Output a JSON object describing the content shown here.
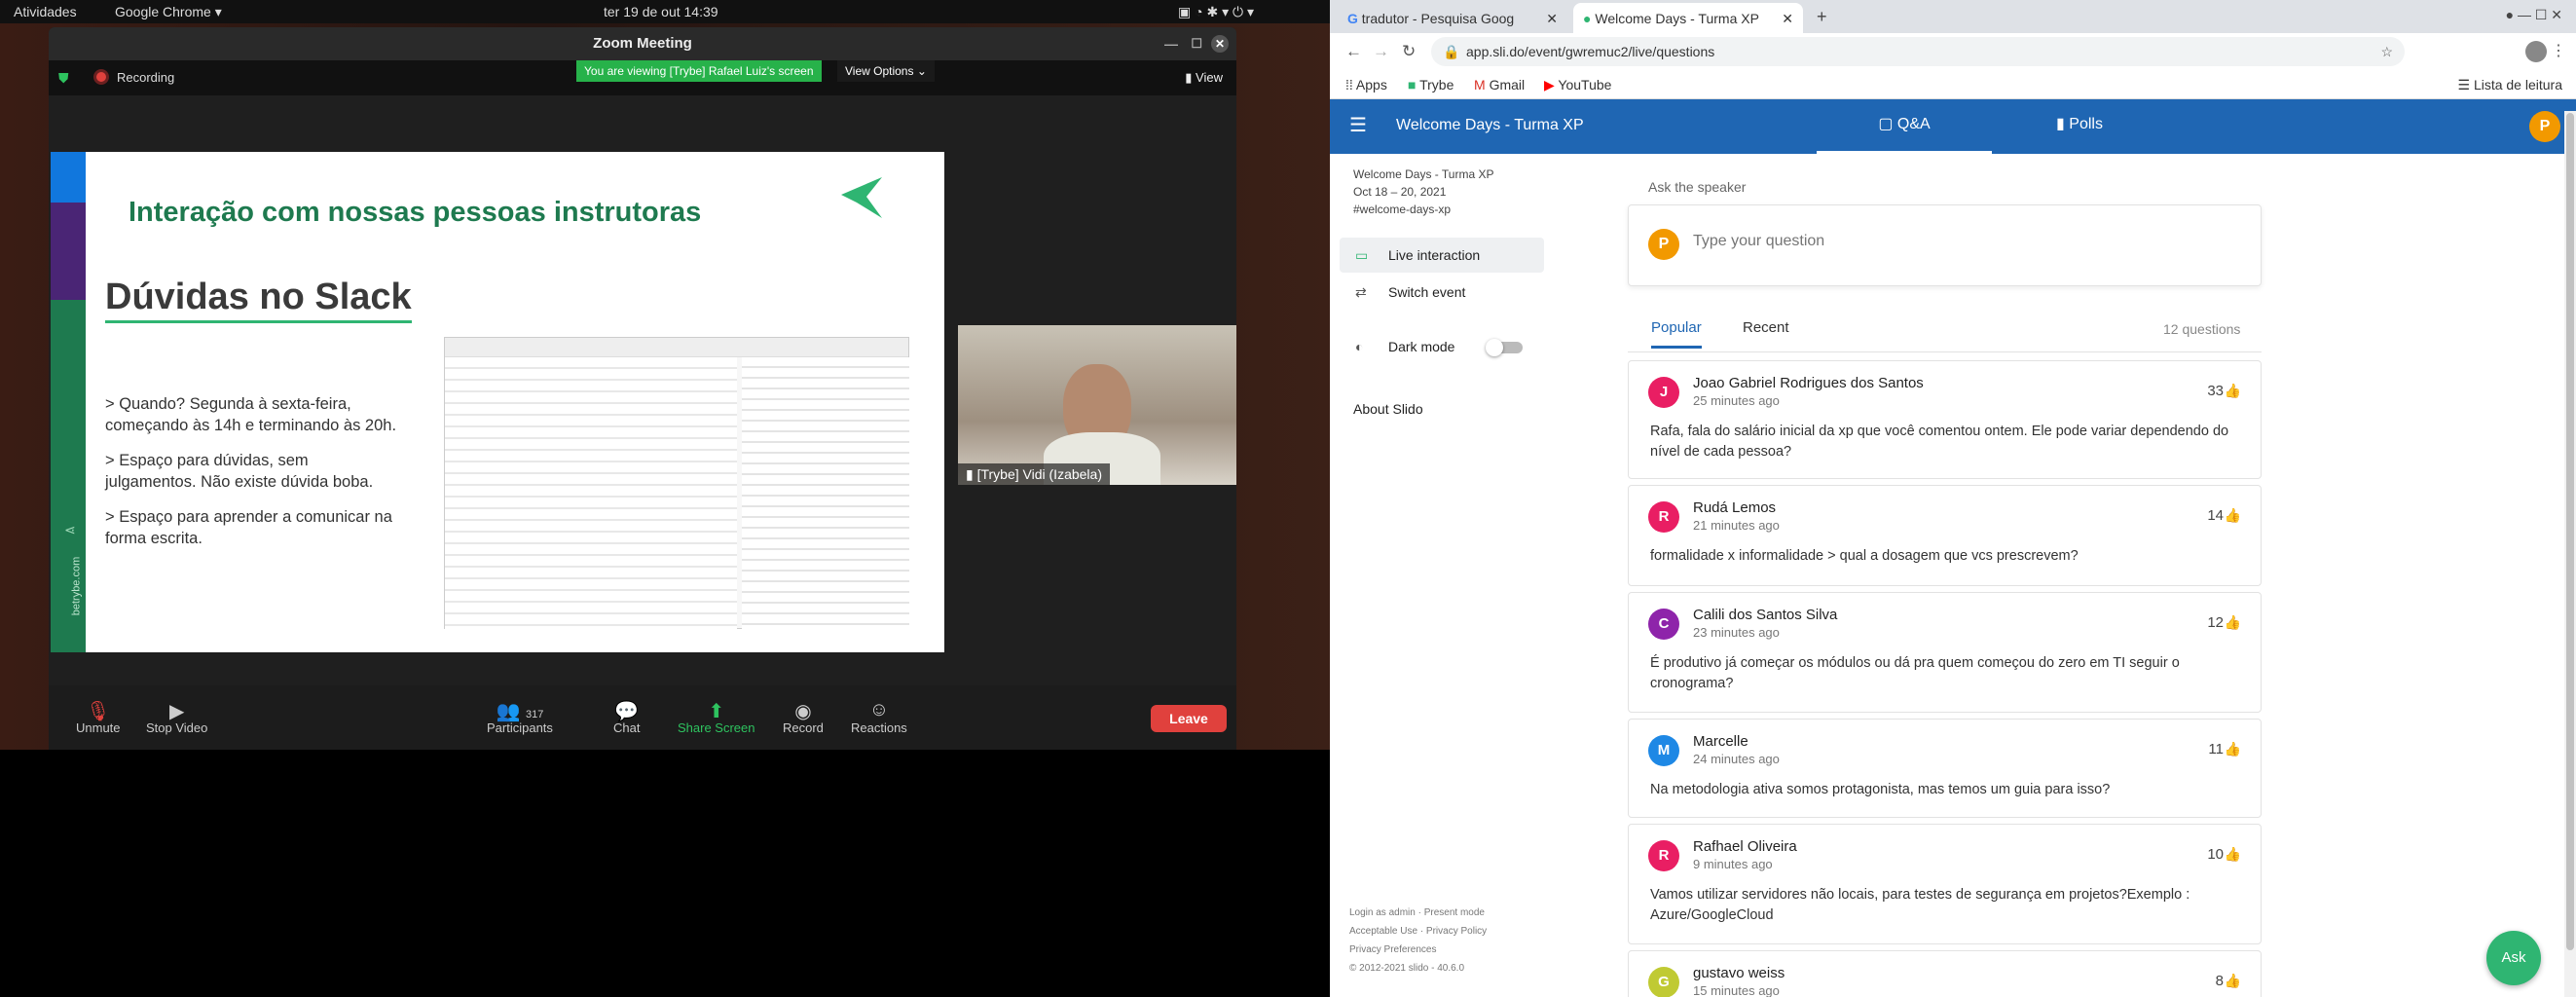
{
  "os_bar": {
    "activities": "Atividades",
    "app": "Google Chrome ▾",
    "clock": "ter 19 de out 14:39"
  },
  "zoom": {
    "title": "Zoom Meeting",
    "recording": "Recording",
    "viewing_banner": "You are viewing [Trybe] Rafael Luiz's screen",
    "view_options": "View Options ⌄",
    "view": "View",
    "participant_name": "[Trybe] Vidi (Izabela)",
    "controls": {
      "unmute": "Unmute",
      "stop_video": "Stop Video",
      "participants": "Participants",
      "participants_count": "317",
      "chat": "Chat",
      "share_screen": "Share Screen",
      "record": "Record",
      "reactions": "Reactions",
      "leave": "Leave"
    },
    "slide": {
      "heading": "Interação com nossas pessoas instrutoras",
      "subheading": "Dúvidas no Slack",
      "bullet1_a": "> Quando? Segunda à sexta-feira,",
      "bullet1_b": "começando às 14h e terminando às 20h.",
      "bullet2_a": "> Espaço para dúvidas, sem",
      "bullet2_b": "julgamentos. Não existe dúvida boba.",
      "bullet3_a": "> Espaço para aprender a comunicar na",
      "bullet3_b": "forma escrita.",
      "site": "betrybe.com"
    }
  },
  "chrome": {
    "tabs": [
      {
        "label": "tradutor - Pesquisa Goog"
      },
      {
        "label": "Welcome Days - Turma XP"
      }
    ],
    "url": "app.sli.do/event/gwremuc2/live/questions",
    "bookmarks": [
      "Apps",
      "Trybe",
      "Gmail",
      "YouTube"
    ],
    "reading_list": "Lista de leitura"
  },
  "slido": {
    "event_title": "Welcome Days - Turma XP",
    "tab_qa": "Q&A",
    "tab_polls": "Polls",
    "user_initial": "P",
    "side_event": "Welcome Days - Turma XP",
    "side_dates": "Oct 18 – 20, 2021",
    "side_code": "#welcome-days-xp",
    "live_interaction": "Live interaction",
    "switch_event": "Switch event",
    "dark_mode": "Dark mode",
    "about": "About Slido",
    "footer": [
      "Login as admin · Present mode",
      "Acceptable Use · Privacy Policy",
      "Privacy Preferences",
      "© 2012-2021 slido - 40.6.0"
    ],
    "ask_label": "Ask the speaker",
    "ask_placeholder": "Type your question",
    "sort_popular": "Popular",
    "sort_recent": "Recent",
    "count": "12 questions",
    "ask_button": "Ask",
    "questions": [
      {
        "initial": "J",
        "color": "#e91e63",
        "name": "Joao Gabriel Rodrigues dos Santos",
        "time": "25 minutes ago",
        "likes": "33",
        "text": "Rafa, fala do salário inicial da xp que você comentou ontem. Ele pode variar dependendo do nível de cada pessoa?"
      },
      {
        "initial": "R",
        "color": "#e91e63",
        "name": "Rudá Lemos",
        "time": "21 minutes ago",
        "likes": "14",
        "text": "formalidade x informalidade > qual a dosagem que vcs prescrevem?"
      },
      {
        "initial": "C",
        "color": "#8e24aa",
        "name": "Calili dos Santos Silva",
        "time": "23 minutes ago",
        "likes": "12",
        "text": "É produtivo já começar os módulos ou dá pra quem começou do zero em TI seguir o cronograma?"
      },
      {
        "initial": "M",
        "color": "#1e88e5",
        "name": "Marcelle",
        "time": "24 minutes ago",
        "likes": "11",
        "text": "Na metodologia ativa somos protagonista, mas temos um guia para isso?"
      },
      {
        "initial": "R",
        "color": "#e91e63",
        "name": "Rafhael Oliveira",
        "time": "9 minutes ago",
        "likes": "10",
        "text": "Vamos utilizar servidores não locais, para testes de segurança em projetos?Exemplo : Azure/GoogleCloud"
      },
      {
        "initial": "G",
        "color": "#c0ca33",
        "name": "gustavo weiss",
        "time": "15 minutes ago",
        "likes": "8",
        "text": ""
      }
    ]
  }
}
